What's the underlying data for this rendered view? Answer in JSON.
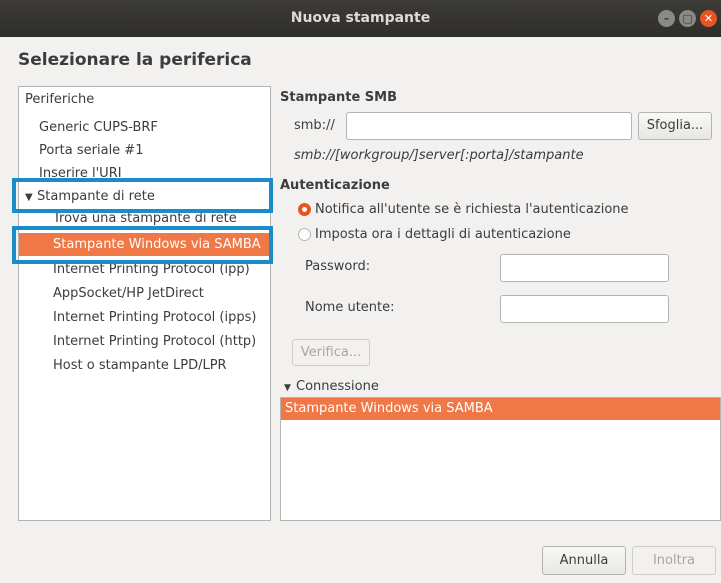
{
  "window": {
    "title": "Nuova stampante",
    "controls": {
      "minimize": "–",
      "maximize": "▢",
      "close": "✕"
    }
  },
  "dialog": {
    "heading": "Selezionare la periferica"
  },
  "devices": {
    "header": "Periferiche",
    "items": [
      {
        "label": "Generic CUPS-BRF"
      },
      {
        "label": "Porta seriale #1"
      },
      {
        "label": "Inserire l'URI"
      },
      {
        "label": "Stampante di rete",
        "expanded": true
      },
      {
        "label": "Trova una stampante di rete"
      },
      {
        "label": "Stampante Windows via SAMBA",
        "selected": true
      },
      {
        "label": "Internet Printing Protocol (ipp)"
      },
      {
        "label": "AppSocket/HP JetDirect"
      },
      {
        "label": "Internet Printing Protocol (ipps)"
      },
      {
        "label": "Internet Printing Protocol (http)"
      },
      {
        "label": "Host o stampante LPD/LPR"
      }
    ],
    "expand_arrow": "▼"
  },
  "smb": {
    "section_title": "Stampante SMB",
    "prefix": "smb://",
    "uri_value": "",
    "browse_label": "Sfoglia...",
    "hint": "smb://[workgroup/]server[:porta]/stampante"
  },
  "auth": {
    "section_title": "Autenticazione",
    "option_notify": "Notifica all'utente se è richiesta l'autenticazione",
    "option_now": "Imposta ora i dettagli di autenticazione",
    "selected_option": "notify",
    "password_label": "Password:",
    "username_label": "Nome utente:",
    "password_value": "",
    "username_value": "",
    "verify_label": "Verifica..."
  },
  "connection": {
    "expand_arrow": "▼",
    "section_title": "Connessione",
    "items": [
      {
        "label": "Stampante Windows via SAMBA",
        "selected": true
      }
    ]
  },
  "footer": {
    "cancel_label": "Annulla",
    "forward_label": "Inoltra"
  },
  "colors": {
    "accent": "#e95420",
    "selection": "#f07746",
    "highlight_box": "#1a8cc7"
  }
}
